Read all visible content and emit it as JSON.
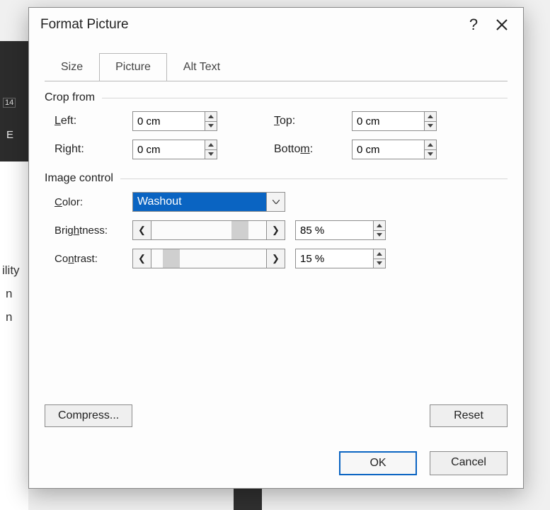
{
  "dialog": {
    "title": "Format Picture",
    "help_label": "?",
    "tabs": {
      "size": "Size",
      "picture": "Picture",
      "alt_text": "Alt Text"
    },
    "crop_section": "Crop from",
    "crop": {
      "left_label_pre": "L",
      "left_label_post": "eft:",
      "right_label_pre": "Ri",
      "right_label_u": "g",
      "right_label_post": "ht:",
      "top_label_u": "T",
      "top_label_post": "op:",
      "bottom_label_pre": "Botto",
      "bottom_label_u": "m",
      "bottom_label_post": ":",
      "left": "0 cm",
      "right": "0 cm",
      "top": "0 cm",
      "bottom": "0 cm"
    },
    "image_section": "Image control",
    "image": {
      "color_label_u": "C",
      "color_label_post": "olor:",
      "brightness_label_pre": "Brig",
      "brightness_label_u": "h",
      "brightness_label_post": "tness:",
      "contrast_label_pre": "Co",
      "contrast_label_u": "n",
      "contrast_label_post": "trast:",
      "color_value": "Washout",
      "brightness_slider_pos": "70%",
      "brightness_value": "85 %",
      "contrast_slider_pos": "10%",
      "contrast_value": "15 %"
    },
    "buttons": {
      "compress": "Compress...",
      "reset": "Reset",
      "ok": "OK",
      "cancel": "Cancel"
    }
  },
  "bg": {
    "frag1": "ility",
    "frag2": "n",
    "frag3": "n",
    "ruler": "14",
    "letter": "E"
  }
}
